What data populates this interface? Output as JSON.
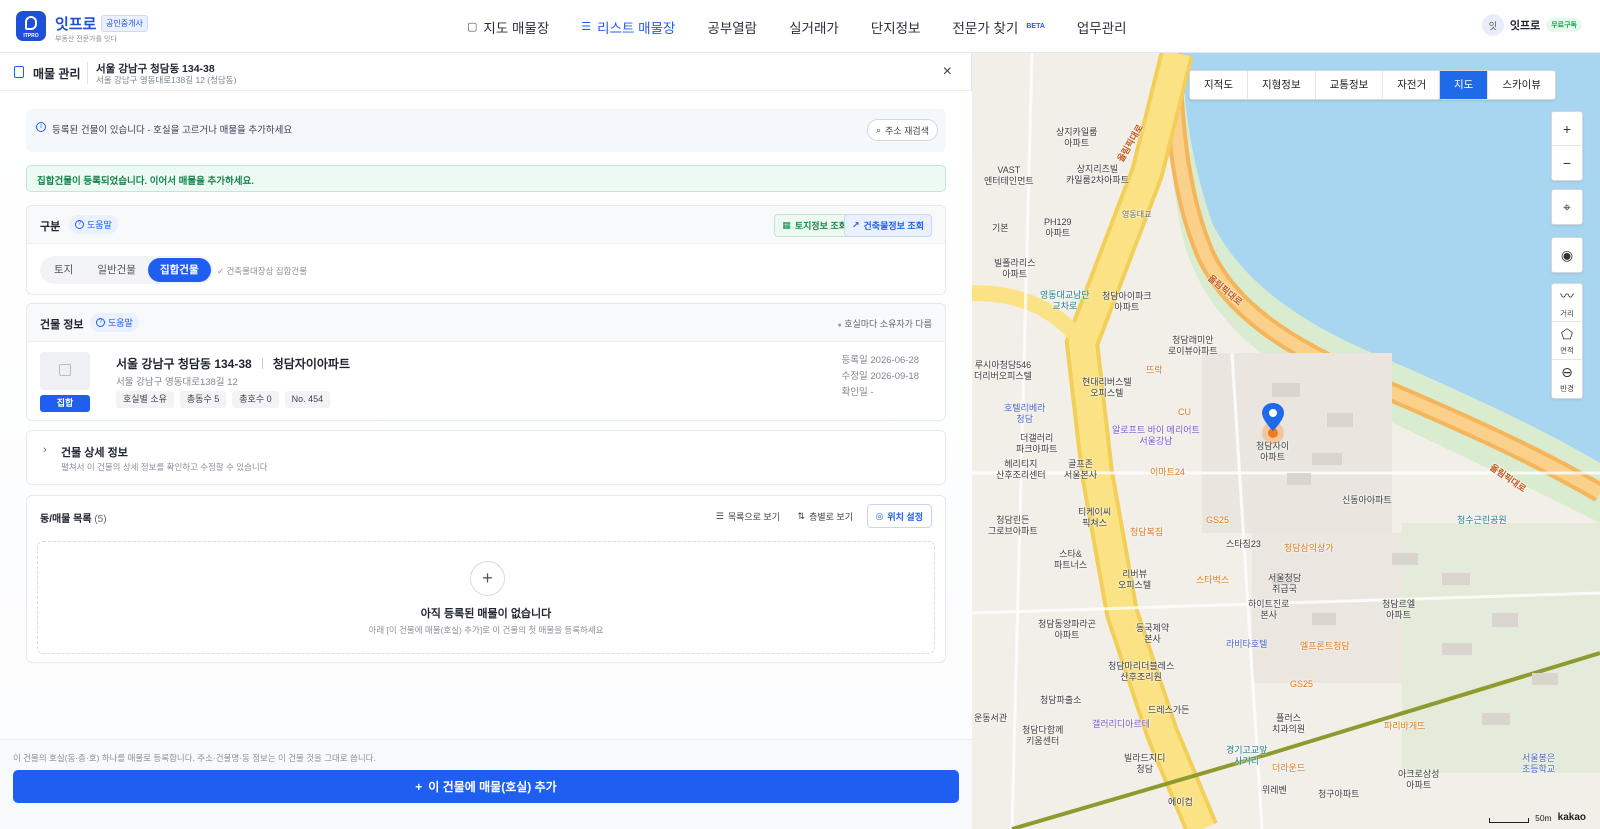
{
  "app": {
    "logo_text": "ITPRO",
    "brand_name": "잇프로",
    "brand_badge": "공인중개사",
    "brand_sub": "부동산 전문가를 잇다"
  },
  "nav": {
    "items": [
      {
        "label": "지도 매물장",
        "icon": "map-icon"
      },
      {
        "label": "리스트 매물장",
        "icon": "list-icon",
        "active": true
      },
      {
        "label": "공부열람"
      },
      {
        "label": "실거래가"
      },
      {
        "label": "단지정보"
      },
      {
        "label": "전문가 찾기",
        "badge": "BETA"
      },
      {
        "label": "업무관리"
      }
    ]
  },
  "user": {
    "avatar": "잇",
    "name": "잇프로",
    "plan": "무료구독"
  },
  "panel": {
    "title": "매물 관리",
    "address_main": "서울 강남구 청담동 134-38",
    "address_sub": "서울 강남구 영동대로138길 12 (청담동)",
    "close": "×"
  },
  "info": {
    "text": "등록된 건물이 있습니다 - 호실을 고르거나 매물을 추가하세요",
    "research_button": "주소 재검색"
  },
  "success_text": "집합건물이 등록되었습니다. 이어서 매물을 추가하세요.",
  "category": {
    "title": "구분",
    "help": "도움말",
    "land_info_button": "토지정보 조회",
    "building_info_button": "건축물정보 조회",
    "options": [
      "토지",
      "일반건물",
      "집합건물"
    ],
    "selected": "집합건물",
    "note": "✓ 건축물대장상 집합건물"
  },
  "building": {
    "title": "건물 정보",
    "help": "도움말",
    "owner_note": "호실마다 소유자가 다름",
    "type_badge": "집합",
    "address": "서울 강남구 청담동 134-38",
    "name": "청담자이아파트",
    "road_address": "서울 강남구 영동대로138길 12",
    "tags": [
      "호실별 소유",
      "총동수 5",
      "총호수 0",
      "No. 454"
    ],
    "registered": "등록일 2026-06-28",
    "modified": "수정일 2026-09-18",
    "confirmed": "확인일 -"
  },
  "detail": {
    "title": "건물 상세 정보",
    "subtitle": "펼쳐서 이 건물의 상세 정보를 확인하고 수정할 수 있습니다"
  },
  "units": {
    "title": "동/매물 목록",
    "count": "(5)",
    "list_view": "목록으로 보기",
    "floor_view": "층별로 보기",
    "location_button": "위치 설정",
    "empty_title": "아직 등록된 매물이 없습니다",
    "empty_sub": "아래 [이 건물에 매물(호실) 추가]로 이 건물의 첫 매물을 등록하세요"
  },
  "footer": {
    "note": "이 건물의 호실(동·층·호) 하나를 매물로 등록합니다. 주소·건물명·동 정보는 이 건물 것을 그대로 씁니다.",
    "cta": "이 건물에 매물(호실) 추가"
  },
  "map": {
    "layers": [
      "지적도",
      "지형정보",
      "교통정보",
      "자전거"
    ],
    "types": [
      "지도",
      "스카이뷰"
    ],
    "active_type": "지도",
    "zoom_in": "+",
    "zoom_out": "−",
    "tool_distance": "거리",
    "tool_area": "면적",
    "tool_radius": "반경",
    "scale": "50m",
    "provider": "kakao",
    "labels": {
      "l1": "상지카일룸\n아파트",
      "l2": "VAST\n엔터테인먼트",
      "l3": "상지리츠빌\n카일룸2차아파트",
      "l4": "PH129\n아파트",
      "l5": "영동대교",
      "l6": "기본",
      "l7": "빌폴라리스\n아파트",
      "l8": "영동대교남단\n교차로",
      "l9": "청담아이파크\n아파트",
      "l10": "청담래미안\n로이뷰아파트",
      "l11": "루시아청담546\n더리버오피스텔",
      "l12": "현대리버스텔\n오피스텔",
      "l13": "뜨락",
      "l14": "호텔리베라\n청담",
      "l15": "CU",
      "l16": "알로프트 바이 메리어트\n서울강남",
      "l17": "더갤러리\n파크아파트",
      "l18": "헤리티지\n산후조리센터",
      "l19": "골프존\n서울본사",
      "l20": "이마트24",
      "l21": "청담자이\n아파트",
      "l22": "신동아아파트",
      "l23": "청수근린공원",
      "l24": "청담린든\n그로브아파트",
      "l25": "티케이씨\n픽쳐스",
      "l26": "청담복집",
      "l27": "GS25",
      "l28": "스타&\n파트너스",
      "l29": "스타짐23",
      "l30": "청담삼익상가",
      "l31": "리버뷰\n오피스텔",
      "l32": "스타벅스",
      "l33": "서울청담\n취급국",
      "l34": "하이트진로\n본사",
      "l35": "청담르엘\n아파트",
      "l36": "동국제약\n본사",
      "l37": "청담동양파라곤\n아파트",
      "l38": "라비타호텔",
      "l39": "엘프론트청담",
      "l40": "청담마리더블레스\n산후조리원",
      "l41": "청담파출소",
      "l42": "드레스가든",
      "l43": "GS25",
      "l44": "갤러리디아르테",
      "l45": "청담다함께\n키움센터",
      "l46": "빌라드지디\n청담",
      "l47": "경기고교앞\n사거리",
      "l48": "에이컵",
      "l49": "위레벤",
      "l50": "청구아파트",
      "l51": "더라운드",
      "l52": "파리바게뜨",
      "l53": "플러스\n치과의원",
      "l54": "아크로삼성\n아파트",
      "l55": "서울봉은\n초등학교",
      "l56": "운동서관",
      "l57": "올림픽대로",
      "l58": "올림픽대로",
      "l59": "올림픽대로"
    }
  }
}
